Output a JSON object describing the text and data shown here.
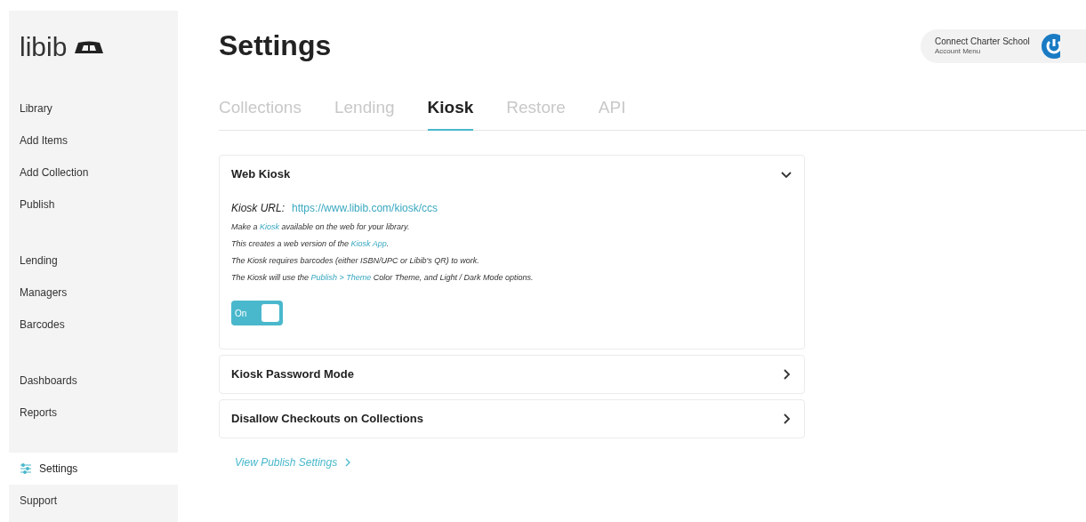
{
  "logo": "libib",
  "sidebar": {
    "groups": [
      [
        {
          "label": "Library",
          "selected": false
        },
        {
          "label": "Add Items",
          "selected": false
        },
        {
          "label": "Add Collection",
          "selected": false
        },
        {
          "label": "Publish",
          "selected": false
        }
      ],
      [
        {
          "label": "Lending",
          "selected": false
        },
        {
          "label": "Managers",
          "selected": false
        },
        {
          "label": "Barcodes",
          "selected": false
        }
      ],
      [
        {
          "label": "Dashboards",
          "selected": false
        },
        {
          "label": "Reports",
          "selected": false
        }
      ],
      [
        {
          "label": "Settings",
          "selected": true
        },
        {
          "label": "Support",
          "selected": false
        }
      ]
    ]
  },
  "page_title": "Settings",
  "account": {
    "name": "Connect Charter School",
    "subtitle": "Account Menu"
  },
  "tabs": [
    {
      "label": "Collections",
      "selected": false
    },
    {
      "label": "Lending",
      "selected": false
    },
    {
      "label": "Kiosk",
      "selected": true
    },
    {
      "label": "Restore",
      "selected": false
    },
    {
      "label": "API",
      "selected": false
    }
  ],
  "panels": [
    {
      "title": "Web Kiosk",
      "expanded": true,
      "url_label": "Kiosk URL:",
      "url": "https://www.libib.com/kiosk/ccs",
      "lines": [
        [
          {
            "kind": "text",
            "text": "Make a "
          },
          {
            "kind": "link",
            "text": "Kiosk"
          },
          {
            "kind": "text",
            "text": " available on the web for your library."
          }
        ],
        [
          {
            "kind": "text",
            "text": "This creates a web version of the "
          },
          {
            "kind": "link",
            "text": "Kiosk App"
          },
          {
            "kind": "text",
            "text": "."
          }
        ],
        [
          {
            "kind": "text",
            "text": "The Kiosk requires barcodes (either ISBN/UPC or Libib's QR) to work."
          }
        ],
        [
          {
            "kind": "text",
            "text": "The Kiosk will use the "
          },
          {
            "kind": "link",
            "text": "Publish > Theme"
          },
          {
            "kind": "text",
            "text": " Color Theme, and Light / Dark Mode options."
          }
        ]
      ],
      "toggle": {
        "label": "On",
        "on": true
      }
    },
    {
      "title": "Kiosk Password Mode",
      "expanded": false
    },
    {
      "title": "Disallow Checkouts on Collections",
      "expanded": false
    }
  ],
  "footer_link": "View Publish Settings"
}
